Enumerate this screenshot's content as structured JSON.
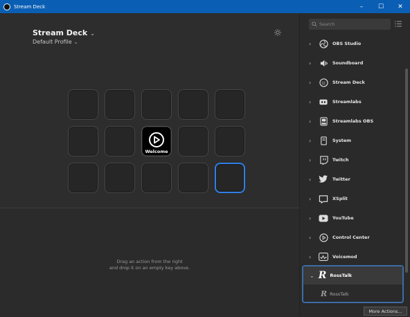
{
  "window": {
    "title": "Stream Deck",
    "controls": [
      "–",
      "☐",
      "✕"
    ]
  },
  "deck": {
    "title": "Stream Deck",
    "title_chevron": "⌄",
    "profile": "Default Profile",
    "profile_chevron": "⌄",
    "welcome_key_label": "Welcome",
    "drop_hint_line1": "Drag an action from the right",
    "drop_hint_line2": "and drop it on an empty key above."
  },
  "sidebar": {
    "search_placeholder": "Search",
    "categories": [
      {
        "label": "OBS Studio",
        "icon": "obs-icon"
      },
      {
        "label": "Soundboard",
        "icon": "speaker-icon"
      },
      {
        "label": "Stream Deck",
        "icon": "stream-deck-icon"
      },
      {
        "label": "Streamlabs",
        "icon": "streamlabs-icon"
      },
      {
        "label": "Streamlabs OBS",
        "icon": "streamlabs-obs-icon"
      },
      {
        "label": "System",
        "icon": "system-icon"
      },
      {
        "label": "Twitch",
        "icon": "twitch-icon"
      },
      {
        "label": "Twitter",
        "icon": "twitter-icon"
      },
      {
        "label": "XSplit",
        "icon": "xsplit-icon"
      },
      {
        "label": "YouTube",
        "icon": "youtube-icon"
      },
      {
        "label": "Control Center",
        "icon": "control-center-icon"
      },
      {
        "label": "Voicemod",
        "icon": "voicemod-icon"
      }
    ],
    "expanded_category": {
      "label": "RossTalk",
      "icon": "rosstalk-logo",
      "glyph": "R",
      "action": "RossTalk"
    },
    "more_actions": "More Actions..."
  },
  "colors": {
    "accent": "#2f7ee6",
    "titlebar": "#0a5fb4"
  }
}
